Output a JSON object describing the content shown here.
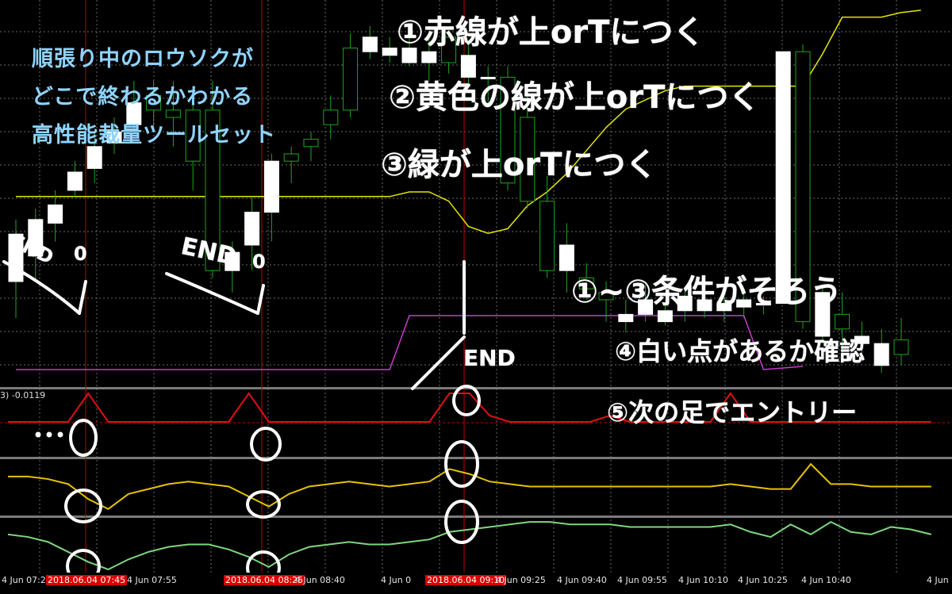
{
  "heading": {
    "line1": "順張り中のロウソクが",
    "line2": "どこで終わるかわかる",
    "line3": "高性能裁量ツールセット"
  },
  "notes": {
    "top1": "①赤線が上orTにつく",
    "top2": "②黄色の線が上orTにつく",
    "top3": "③緑が上orTにつく",
    "cond": "①~③条件がそろう",
    "n4": "④白い点があるか確認",
    "n5": "⑤次の足でエントリー",
    "end1": "END",
    "end2": "END",
    "end3": "END",
    "zero1": "0",
    "zero2": "0"
  },
  "indicator_label": "3) -0.0119",
  "time_labels": [
    {
      "text": "4 Jun 07:25",
      "highlight": false
    },
    {
      "text": "2018.06.04 07:45",
      "highlight": true
    },
    {
      "text": "4 Jun 07:55",
      "highlight": false
    },
    {
      "text": "2018.06.04 08:25",
      "highlight": true
    },
    {
      "text": "4 Jun 08:40",
      "highlight": false
    },
    {
      "text": "4 Jun 0",
      "highlight": false
    },
    {
      "text": "2018.06.04 09:10",
      "highlight": true
    },
    {
      "text": "4 Jun 09:25",
      "highlight": false
    },
    {
      "text": "4 Jun 09:40",
      "highlight": false
    },
    {
      "text": "4 Jun 09:55",
      "highlight": false
    },
    {
      "text": "4 Jun 10:10",
      "highlight": false
    },
    {
      "text": "4 Jun 10:25",
      "highlight": false
    },
    {
      "text": "4 Jun 10:40",
      "highlight": false
    },
    {
      "text": "4 Jun",
      "highlight": false
    }
  ],
  "colors": {
    "background": "#000000",
    "grid": "#6a6a6a",
    "bull": "#ffffff",
    "bear_border": "#1fa51f",
    "upper_band": "#e6e600",
    "lower_band": "#c83cc8",
    "red_line": "#e01010",
    "yellow_line": "#e6c200",
    "green_line": "#7fd67f",
    "vline": "#c00000",
    "time_highlight": "#d80000"
  },
  "chart_data": {
    "type": "candlestick",
    "candles": [
      {
        "o": 0.38,
        "c": 0.25,
        "h": 0.15,
        "l": 0.42
      },
      {
        "o": 0.42,
        "c": 0.32,
        "h": 0.25,
        "l": 0.45
      },
      {
        "o": 0.46,
        "c": 0.41,
        "h": 0.36,
        "l": 0.5
      },
      {
        "o": 0.55,
        "c": 0.5,
        "h": 0.48,
        "l": 0.58
      },
      {
        "o": 0.62,
        "c": 0.56,
        "h": 0.52,
        "l": 0.66
      },
      {
        "o": 0.66,
        "c": 0.63,
        "h": 0.6,
        "l": 0.7
      },
      {
        "o": 0.74,
        "c": 0.68,
        "h": 0.66,
        "l": 0.8
      },
      {
        "o": 0.72,
        "c": 0.76,
        "h": 0.66,
        "l": 0.8
      },
      {
        "o": 0.7,
        "c": 0.72,
        "h": 0.62,
        "l": 0.8
      },
      {
        "o": 0.58,
        "c": 0.72,
        "h": 0.5,
        "l": 0.74
      },
      {
        "o": 0.28,
        "c": 0.72,
        "h": 0.26,
        "l": 0.8
      },
      {
        "o": 0.33,
        "c": 0.28,
        "h": 0.22,
        "l": 0.36
      },
      {
        "o": 0.44,
        "c": 0.35,
        "h": 0.28,
        "l": 0.48
      },
      {
        "o": 0.58,
        "c": 0.44,
        "h": 0.36,
        "l": 0.6
      },
      {
        "o": 0.58,
        "c": 0.6,
        "h": 0.52,
        "l": 0.62
      },
      {
        "o": 0.62,
        "c": 0.64,
        "h": 0.58,
        "l": 0.66
      },
      {
        "o": 0.68,
        "c": 0.72,
        "h": 0.64,
        "l": 0.76
      },
      {
        "o": 0.72,
        "c": 0.89,
        "h": 0.7,
        "l": 0.93
      },
      {
        "o": 0.92,
        "c": 0.88,
        "h": 0.86,
        "l": 0.95
      },
      {
        "o": 0.89,
        "c": 0.87,
        "h": 0.85,
        "l": 0.92
      },
      {
        "o": 0.89,
        "c": 0.85,
        "h": 0.84,
        "l": 0.92
      },
      {
        "o": 0.88,
        "c": 0.85,
        "h": 0.8,
        "l": 0.92
      },
      {
        "o": 0.85,
        "c": 0.92,
        "h": 0.82,
        "l": 0.94
      },
      {
        "o": 0.87,
        "c": 0.81,
        "h": 0.79,
        "l": 0.9
      },
      {
        "o": 0.81,
        "c": 0.81,
        "h": 0.74,
        "l": 0.84
      },
      {
        "o": 0.52,
        "c": 0.81,
        "h": 0.5,
        "l": 0.84
      },
      {
        "o": 0.47,
        "c": 0.7,
        "h": 0.45,
        "l": 0.76
      },
      {
        "o": 0.28,
        "c": 0.47,
        "h": 0.26,
        "l": 0.54
      },
      {
        "o": 0.35,
        "c": 0.28,
        "h": 0.22,
        "l": 0.41
      },
      {
        "o": 0.23,
        "c": 0.26,
        "h": 0.2,
        "l": 0.3
      },
      {
        "o": 0.2,
        "c": 0.22,
        "h": 0.14,
        "l": 0.25
      },
      {
        "o": 0.16,
        "c": 0.14,
        "h": 0.11,
        "l": 0.2
      },
      {
        "o": 0.2,
        "c": 0.16,
        "h": 0.14,
        "l": 0.24
      },
      {
        "o": 0.17,
        "c": 0.14,
        "h": 0.13,
        "l": 0.19
      },
      {
        "o": 0.21,
        "c": 0.17,
        "h": 0.14,
        "l": 0.23
      },
      {
        "o": 0.2,
        "c": 0.17,
        "h": 0.15,
        "l": 0.22
      },
      {
        "o": 0.19,
        "c": 0.17,
        "h": 0.14,
        "l": 0.21
      },
      {
        "o": 0.2,
        "c": 0.18,
        "h": 0.15,
        "l": 0.22
      },
      {
        "o": 0.19,
        "c": 0.19,
        "h": 0.16,
        "l": 0.21
      },
      {
        "o": 0.88,
        "c": 0.19,
        "h": 0.86,
        "l": 0.21
      },
      {
        "o": 0.14,
        "c": 0.88,
        "h": 0.12,
        "l": 0.9
      },
      {
        "o": 0.22,
        "c": 0.1,
        "h": 0.08,
        "l": 0.24
      },
      {
        "o": 0.12,
        "c": 0.16,
        "h": 0.05,
        "l": 0.22
      },
      {
        "o": 0.1,
        "c": 0.08,
        "h": 0.04,
        "l": 0.14
      },
      {
        "o": 0.08,
        "c": 0.02,
        "h": 0.0,
        "l": 0.12
      },
      {
        "o": 0.05,
        "c": 0.09,
        "h": 0.02,
        "l": 0.15
      }
    ],
    "upper_band": [
      0.18,
      0.18,
      0.18,
      0.18,
      0.18,
      0.18,
      0.18,
      0.18,
      0.18,
      0.18,
      0.18,
      0.18,
      0.18,
      0.18,
      0.18,
      0.18,
      0.18,
      0.18,
      0.18,
      0.18,
      0.2,
      0.2,
      0.16,
      0.05,
      0.02,
      0.04,
      0.14,
      0.2,
      0.28,
      0.38,
      0.48,
      0.56,
      0.6,
      0.64,
      0.66,
      0.66,
      0.66,
      0.66,
      0.66,
      0.66,
      0.66,
      0.8,
      0.96,
      0.96,
      0.96,
      0.98,
      0.99
    ],
    "lower_band": [
      0.02,
      0.02,
      0.02,
      0.02,
      0.02,
      0.02,
      0.02,
      0.02,
      0.02,
      0.02,
      0.02,
      0.02,
      0.02,
      0.02,
      0.02,
      0.02,
      0.02,
      0.02,
      0.02,
      0.02,
      0.01,
      0.01,
      0.01,
      0.01,
      0.01,
      0.01,
      0.01,
      0.01,
      0.01,
      0.01,
      0.01,
      0.01,
      0.01,
      0.01,
      0.01,
      0.01,
      0.01,
      0.01,
      0.02,
      0.03,
      0.04
    ],
    "red_line": [
      0.5,
      0.5,
      0.5,
      0.5,
      0.95,
      0.5,
      0.5,
      0.5,
      0.5,
      0.5,
      0.5,
      0.5,
      0.95,
      0.5,
      0.5,
      0.5,
      0.5,
      0.5,
      0.5,
      0.5,
      0.5,
      0.5,
      0.95,
      0.95,
      0.6,
      0.5,
      0.5,
      0.5,
      0.5,
      0.5,
      0.6,
      0.5,
      0.5,
      0.5,
      0.5,
      0.5,
      0.95,
      0.5,
      0.5,
      0.5,
      0.5,
      0.5,
      0.5,
      0.5,
      0.5,
      0.5,
      0.5
    ],
    "yellow_line": [
      0.7,
      0.7,
      0.65,
      0.55,
      0.25,
      0.05,
      0.35,
      0.45,
      0.55,
      0.6,
      0.55,
      0.5,
      0.3,
      0.1,
      0.35,
      0.5,
      0.55,
      0.6,
      0.55,
      0.5,
      0.55,
      0.6,
      0.85,
      0.75,
      0.6,
      0.55,
      0.5,
      0.5,
      0.5,
      0.5,
      0.5,
      0.5,
      0.5,
      0.5,
      0.5,
      0.5,
      0.55,
      0.5,
      0.45,
      0.45,
      0.95,
      0.55,
      0.55,
      0.5,
      0.5,
      0.5,
      0.5
    ],
    "green_line": [
      0.7,
      0.65,
      0.55,
      0.35,
      0.15,
      0.0,
      0.2,
      0.35,
      0.45,
      0.5,
      0.5,
      0.4,
      0.25,
      0.05,
      0.3,
      0.45,
      0.5,
      0.55,
      0.5,
      0.5,
      0.55,
      0.6,
      0.75,
      0.8,
      0.85,
      0.9,
      0.95,
      0.95,
      0.9,
      0.9,
      0.9,
      0.85,
      0.85,
      0.85,
      0.85,
      0.85,
      0.9,
      0.75,
      0.65,
      0.9,
      0.7,
      0.95,
      0.75,
      0.7,
      0.85,
      0.8,
      0.7
    ]
  }
}
